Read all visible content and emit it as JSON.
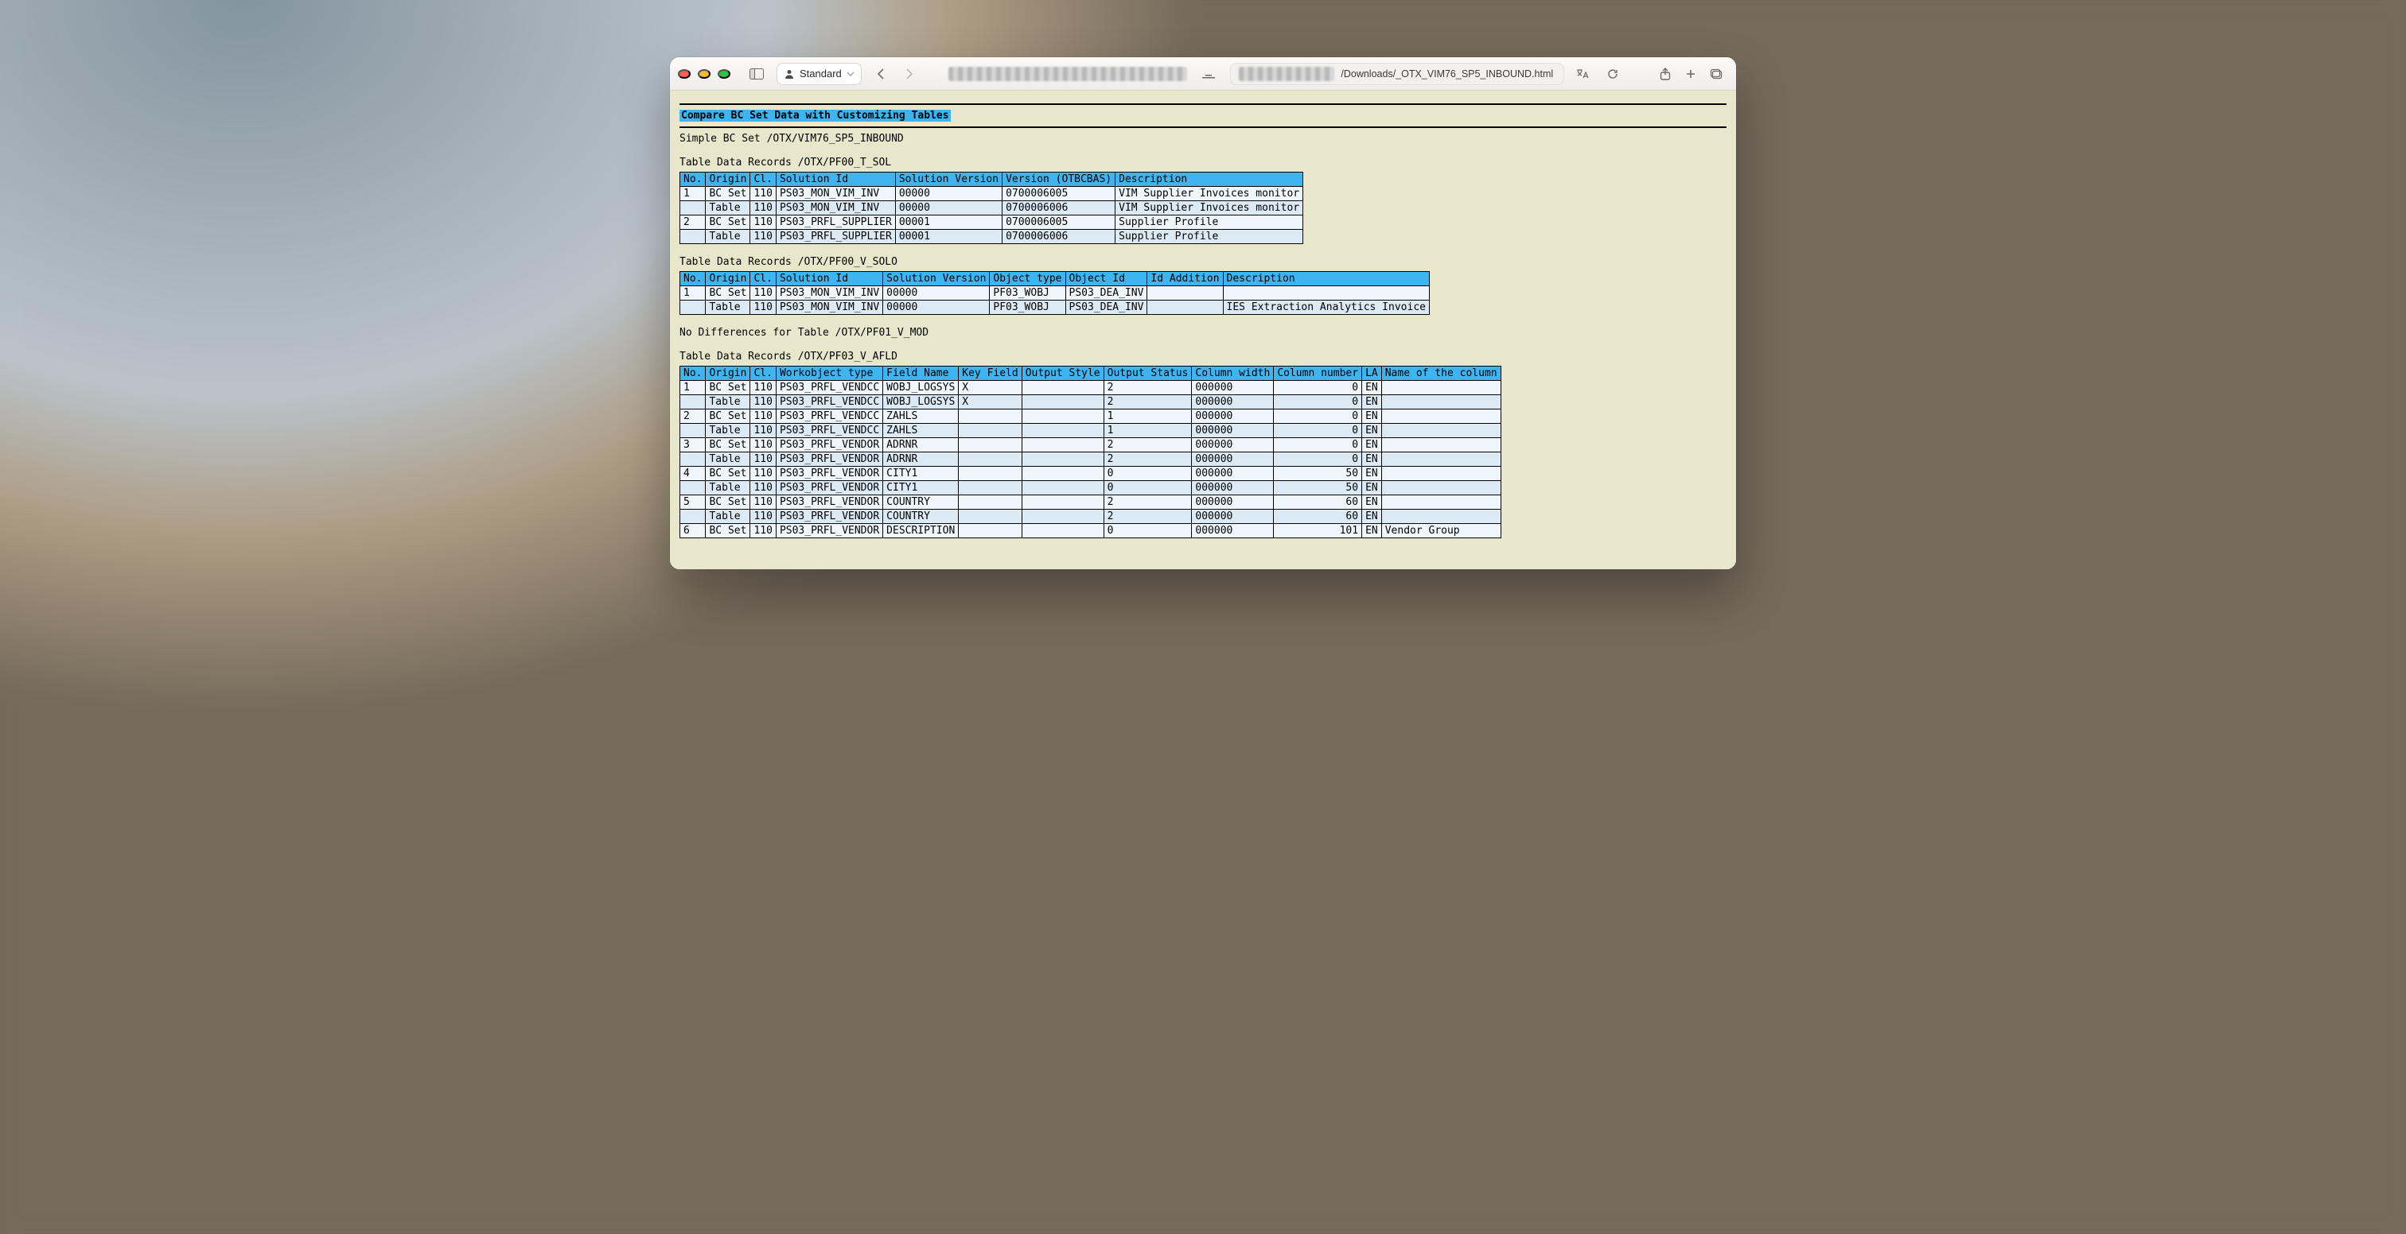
{
  "toolbar": {
    "profile_label": "Standard",
    "url_visible_suffix": "/Downloads/_OTX_VIM76_SP5_INBOUND.html"
  },
  "page": {
    "title_bar": "Compare BC Set Data with Customizing Tables",
    "subtitle": "Simple BC Set /OTX/VIM76_SP5_INBOUND",
    "no_diff_line": "No Differences for Table /OTX/PF01_V_MOD",
    "tables": {
      "t_sol": {
        "caption": "Table Data Records /OTX/PF00_T_SOL",
        "headers": [
          "No.",
          "Origin",
          "Cl.",
          "Solution Id",
          "Solution Version",
          "Version (OTBCBAS)",
          "Description"
        ],
        "rows": [
          {
            "cells": [
              "1",
              "BC Set",
              "110",
              "PS03_MON_VIM_INV",
              "00000",
              "0700006005",
              "VIM Supplier Invoices monitor"
            ],
            "cls": "a"
          },
          {
            "cells": [
              "",
              "Table",
              "110",
              "PS03_MON_VIM_INV",
              "00000",
              "0700006006",
              "VIM Supplier Invoices monitor"
            ],
            "cls": "b",
            "hl": [
              5
            ]
          },
          {
            "cells": [
              "2",
              "BC Set",
              "110",
              "PS03_PRFL_SUPPLIER",
              "00001",
              "0700006005",
              "Supplier Profile"
            ],
            "cls": "a"
          },
          {
            "cells": [
              "",
              "Table",
              "110",
              "PS03_PRFL_SUPPLIER",
              "00001",
              "0700006006",
              "Supplier Profile"
            ],
            "cls": "b",
            "hl": [
              5
            ]
          }
        ]
      },
      "v_solo": {
        "caption": "Table Data Records /OTX/PF00_V_SOLO",
        "headers": [
          "No.",
          "Origin",
          "Cl.",
          "Solution Id",
          "Solution Version",
          "Object type",
          "Object Id",
          "Id Addition",
          "Description"
        ],
        "rows": [
          {
            "cells": [
              "1",
              "BC Set",
              "110",
              "PS03_MON_VIM_INV",
              "00000",
              "PF03_WOBJ",
              "PS03_DEA_INV",
              "",
              ""
            ],
            "cls": "a"
          },
          {
            "cells": [
              "",
              "Table",
              "110",
              "PS03_MON_VIM_INV",
              "00000",
              "PF03_WOBJ",
              "PS03_DEA_INV",
              "",
              "IES Extraction Analytics Invoice"
            ],
            "cls": "b",
            "hl": [
              8
            ]
          }
        ]
      },
      "v_afld": {
        "caption": "Table Data Records /OTX/PF03_V_AFLD",
        "headers": [
          "No.",
          "Origin",
          "Cl.",
          "Workobject type",
          "Field Name",
          "Key Field",
          "Output Style",
          "Output Status",
          "Column width",
          "Column number",
          "LA",
          "Name of the column"
        ],
        "rows": [
          {
            "cells": [
              "1",
              "BC Set",
              "110",
              "PS03_PRFL_VENDCC",
              "WOBJ_LOGSYS",
              "X",
              "",
              "2",
              "000000",
              "0",
              "EN",
              ""
            ],
            "cls": "a",
            "hls": [
              9
            ],
            "ra": [
              9
            ]
          },
          {
            "cells": [
              "",
              "Table",
              "110",
              "PS03_PRFL_VENDCC",
              "WOBJ_LOGSYS",
              "X",
              "",
              "2",
              "000000",
              "0",
              "EN",
              ""
            ],
            "cls": "b",
            "hl": [
              9
            ],
            "ra": [
              9
            ]
          },
          {
            "cells": [
              "2",
              "BC Set",
              "110",
              "PS03_PRFL_VENDCC",
              "ZAHLS",
              "",
              "",
              "1",
              "000000",
              "0",
              "EN",
              ""
            ],
            "cls": "a",
            "hls": [
              9
            ],
            "ra": [
              9
            ]
          },
          {
            "cells": [
              "",
              "Table",
              "110",
              "PS03_PRFL_VENDCC",
              "ZAHLS",
              "",
              "",
              "1",
              "000000",
              "0",
              "EN",
              ""
            ],
            "cls": "b",
            "hl": [
              9
            ],
            "ra": [
              9
            ]
          },
          {
            "cells": [
              "3",
              "BC Set",
              "110",
              "PS03_PRFL_VENDOR",
              "ADRNR",
              "",
              "",
              "2",
              "000000",
              "0",
              "EN",
              ""
            ],
            "cls": "a",
            "hls": [
              9
            ],
            "ra": [
              9
            ]
          },
          {
            "cells": [
              "",
              "Table",
              "110",
              "PS03_PRFL_VENDOR",
              "ADRNR",
              "",
              "",
              "2",
              "000000",
              "0",
              "EN",
              ""
            ],
            "cls": "b",
            "hl": [
              9
            ],
            "ra": [
              9
            ]
          },
          {
            "cells": [
              "4",
              "BC Set",
              "110",
              "PS03_PRFL_VENDOR",
              "CITY1",
              "",
              "",
              "0",
              "000000",
              "50",
              "EN",
              ""
            ],
            "cls": "a",
            "hls": [
              9
            ],
            "ra": [
              9
            ]
          },
          {
            "cells": [
              "",
              "Table",
              "110",
              "PS03_PRFL_VENDOR",
              "CITY1",
              "",
              "",
              "0",
              "000000",
              "50",
              "EN",
              ""
            ],
            "cls": "b",
            "hl": [
              9
            ],
            "ra": [
              9
            ]
          },
          {
            "cells": [
              "5",
              "BC Set",
              "110",
              "PS03_PRFL_VENDOR",
              "COUNTRY",
              "",
              "",
              "2",
              "000000",
              "60",
              "EN",
              ""
            ],
            "cls": "a",
            "hls": [
              9
            ],
            "ra": [
              9
            ]
          },
          {
            "cells": [
              "",
              "Table",
              "110",
              "PS03_PRFL_VENDOR",
              "COUNTRY",
              "",
              "",
              "2",
              "000000",
              "60",
              "EN",
              ""
            ],
            "cls": "b",
            "hl": [
              9
            ],
            "ra": [
              9
            ]
          },
          {
            "cells": [
              "6",
              "BC Set",
              "110",
              "PS03_PRFL_VENDOR",
              "DESCRIPTION",
              "",
              "",
              "0",
              "000000",
              "101",
              "EN",
              "Vendor Group"
            ],
            "cls": "a",
            "hls": [
              9
            ],
            "ra": [
              9
            ]
          }
        ]
      }
    }
  }
}
